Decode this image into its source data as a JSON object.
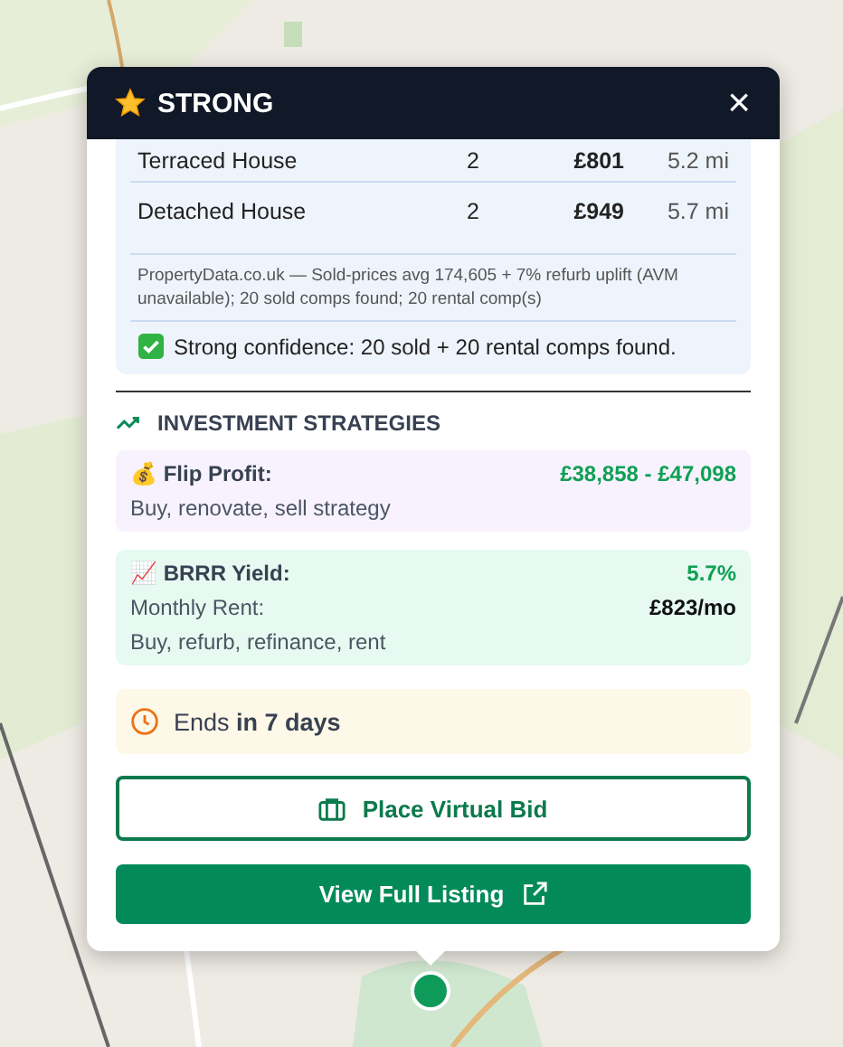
{
  "popup": {
    "title": "STRONG",
    "close": "×",
    "comps": [
      {
        "type": "Terraced House",
        "beds": "2",
        "rent": "£801",
        "distance": "5.2 mi"
      },
      {
        "type": "Detached House",
        "beds": "2",
        "rent": "£949",
        "distance": "5.7 mi"
      }
    ],
    "source_note": "PropertyData.co.uk — Sold-prices avg 174,605 + 7% refurb uplift (AVM unavailable); 20 sold comps found; 20 rental comp(s)",
    "confidence": "Strong confidence: 20 sold + 20 rental comps found.",
    "strategies_heading": "INVESTMENT STRATEGIES",
    "strategies": [
      {
        "kind": "flip",
        "icon": "💰",
        "name": "Flip Profit:",
        "value": "£38,858 - £47,098",
        "description": "Buy, renovate, sell strategy"
      },
      {
        "kind": "brrr",
        "icon": "📈",
        "name": "BRRR Yield:",
        "value": "5.7%",
        "rent_label": "Monthly Rent:",
        "rent_value": "£823/mo",
        "description": "Buy, refurb, refinance, rent"
      }
    ],
    "ends": "Ends **in 7 days**",
    "buttons": [
      {
        "kind": "outline",
        "label": "Place Virtual Bid"
      },
      {
        "kind": "filled",
        "label": "View Full Listing"
      }
    ]
  }
}
